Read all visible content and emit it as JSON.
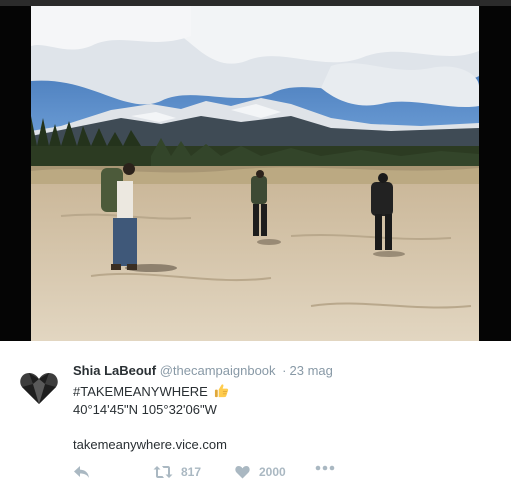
{
  "tweet": {
    "author_name": "Shia LaBeouf",
    "handle": "@thecampaignbook",
    "separator": "·",
    "time": "23 mag",
    "text_line1": "#TAKEMEANYWHERE",
    "text_line2": "40°14'45\"N 105°32'06\"W",
    "link": "takemeanywhere.vice.com"
  },
  "actions": {
    "retweet_count": "817",
    "like_count": "2000"
  },
  "icons": [
    "heart-avatar-icon",
    "thumbs-up-emoji-icon",
    "reply-icon",
    "retweet-icon",
    "heart-icon",
    "more-icon"
  ],
  "colors": {
    "name": "#292f33",
    "meta": "#8899a6",
    "action": "#aab8c2",
    "emoji": "#ffcc4d"
  }
}
